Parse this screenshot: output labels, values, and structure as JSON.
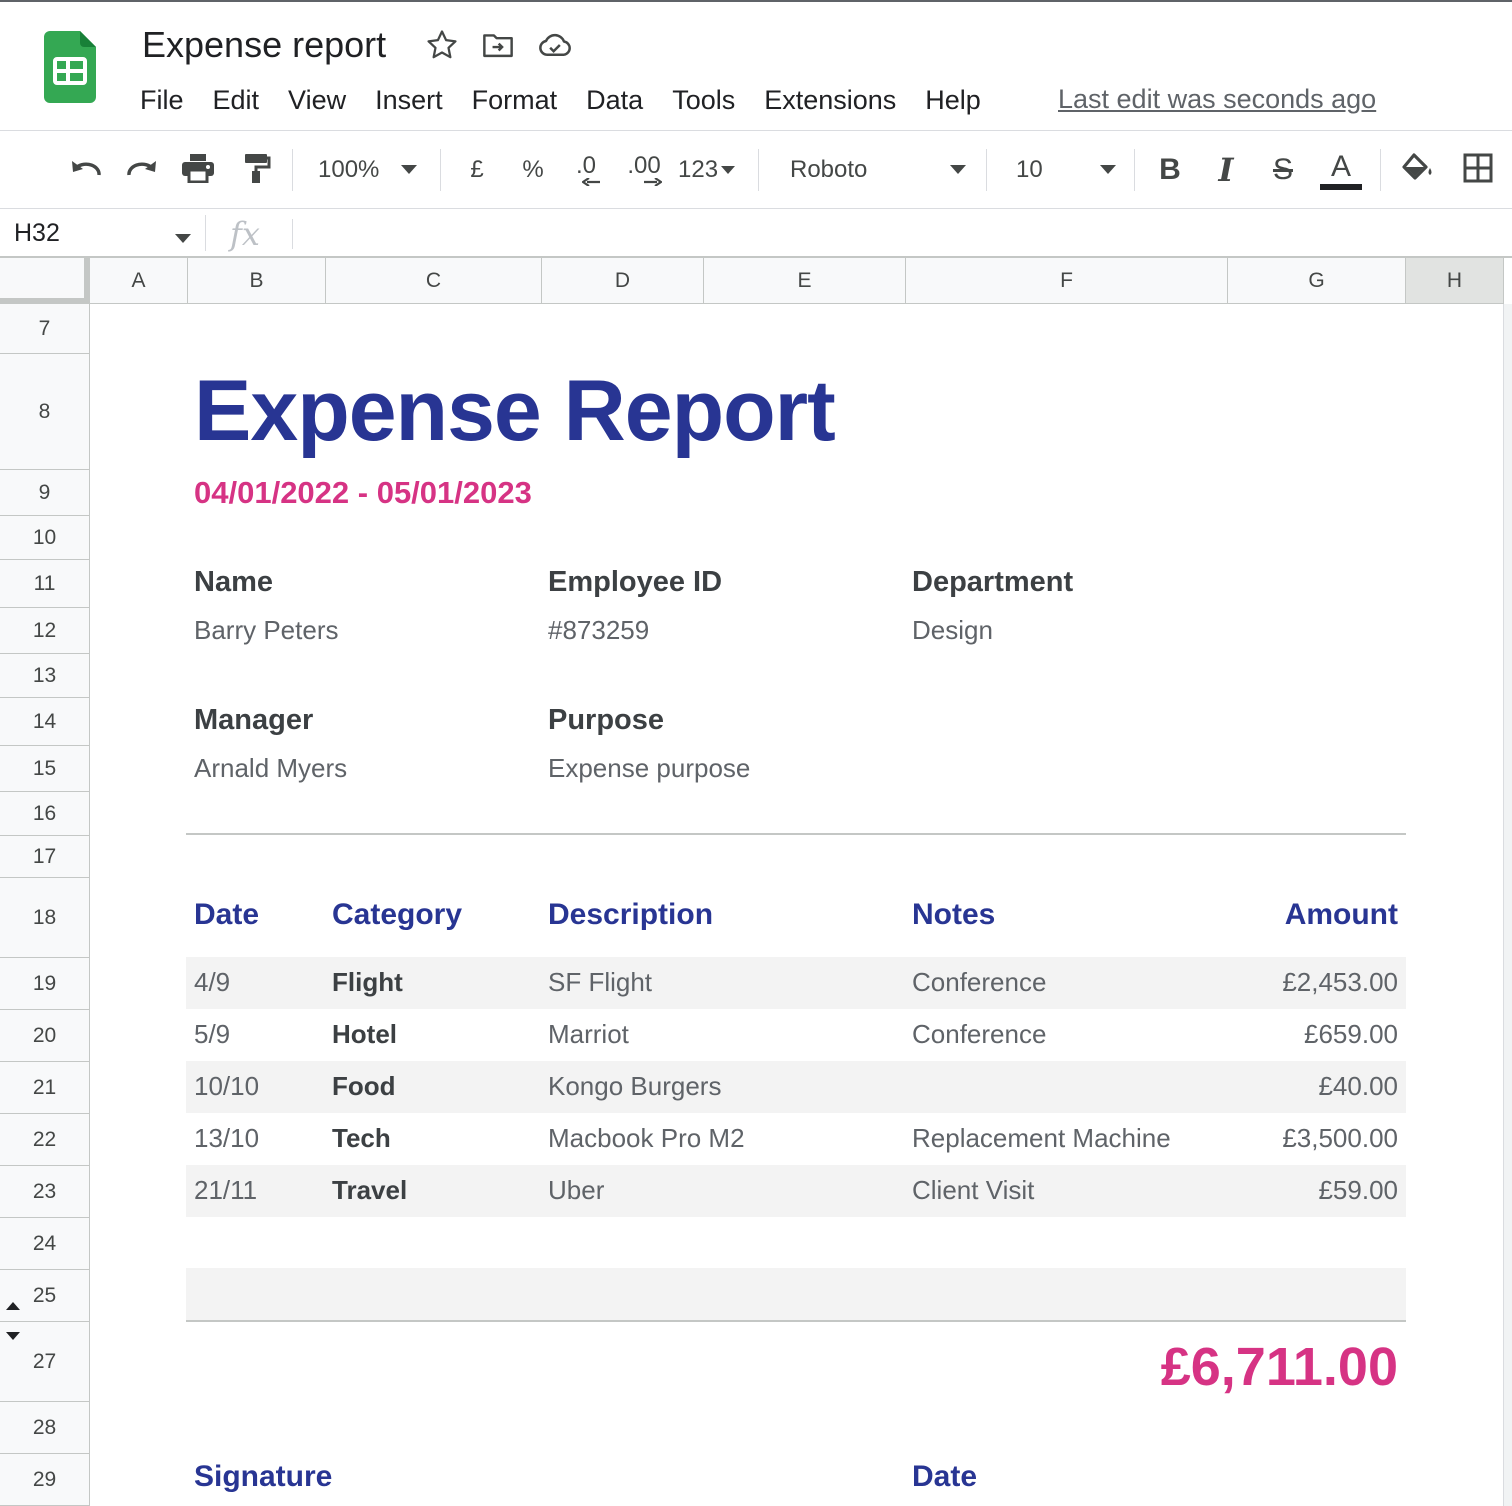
{
  "app": {
    "doc_title": "Expense report",
    "last_edit": "Last edit was seconds ago",
    "menu": [
      "File",
      "Edit",
      "View",
      "Insert",
      "Format",
      "Data",
      "Tools",
      "Extensions",
      "Help"
    ]
  },
  "toolbar": {
    "zoom": "100%",
    "currency": "£",
    "percent": "%",
    "decrease_decimal": ".0",
    "increase_decimal": ".00",
    "number_format": "123",
    "font": "Roboto",
    "font_size": "10",
    "bold": "B",
    "italic": "I",
    "strike": "S",
    "text_color": "A",
    "text_color_value": "#202124"
  },
  "formula_bar": {
    "cell_ref": "H32",
    "fx": "fx",
    "value": ""
  },
  "grid": {
    "columns": [
      "A",
      "B",
      "C",
      "D",
      "E",
      "F",
      "G",
      "H"
    ],
    "selected_column": "H",
    "rows": [
      "7",
      "8",
      "9",
      "10",
      "11",
      "12",
      "13",
      "14",
      "15",
      "16",
      "17",
      "18",
      "19",
      "20",
      "21",
      "22",
      "23",
      "24",
      "25",
      "27",
      "28",
      "29"
    ]
  },
  "sheet": {
    "title": "Expense Report",
    "date_range": "04/01/2022 - 05/01/2023",
    "fields": {
      "name_label": "Name",
      "name_value": "Barry Peters",
      "employee_id_label": "Employee ID",
      "employee_id_value": "#873259",
      "department_label": "Department",
      "department_value": "Design",
      "manager_label": "Manager",
      "manager_value": "Arnald Myers",
      "purpose_label": "Purpose",
      "purpose_value": "Expense purpose"
    },
    "table": {
      "headers": {
        "date": "Date",
        "category": "Category",
        "description": "Description",
        "notes": "Notes",
        "amount": "Amount"
      },
      "rows": [
        {
          "date": "4/9",
          "category": "Flight",
          "description": "SF Flight",
          "notes": "Conference",
          "amount": "£2,453.00"
        },
        {
          "date": "5/9",
          "category": "Hotel",
          "description": "Marriot",
          "notes": "Conference",
          "amount": "£659.00"
        },
        {
          "date": "10/10",
          "category": "Food",
          "description": "Kongo Burgers",
          "notes": "",
          "amount": "£40.00"
        },
        {
          "date": "13/10",
          "category": "Tech",
          "description": "Macbook Pro M2",
          "notes": "Replacement Machine",
          "amount": "£3,500.00"
        },
        {
          "date": "21/11",
          "category": "Travel",
          "description": "Uber",
          "notes": "Client Visit",
          "amount": "£59.00"
        }
      ]
    },
    "total": "£6,711.00",
    "signature_label": "Signature",
    "date_label": "Date"
  },
  "colors": {
    "title_blue": "#283593",
    "accent_pink": "#d63384",
    "sheets_green": "#34a853"
  }
}
